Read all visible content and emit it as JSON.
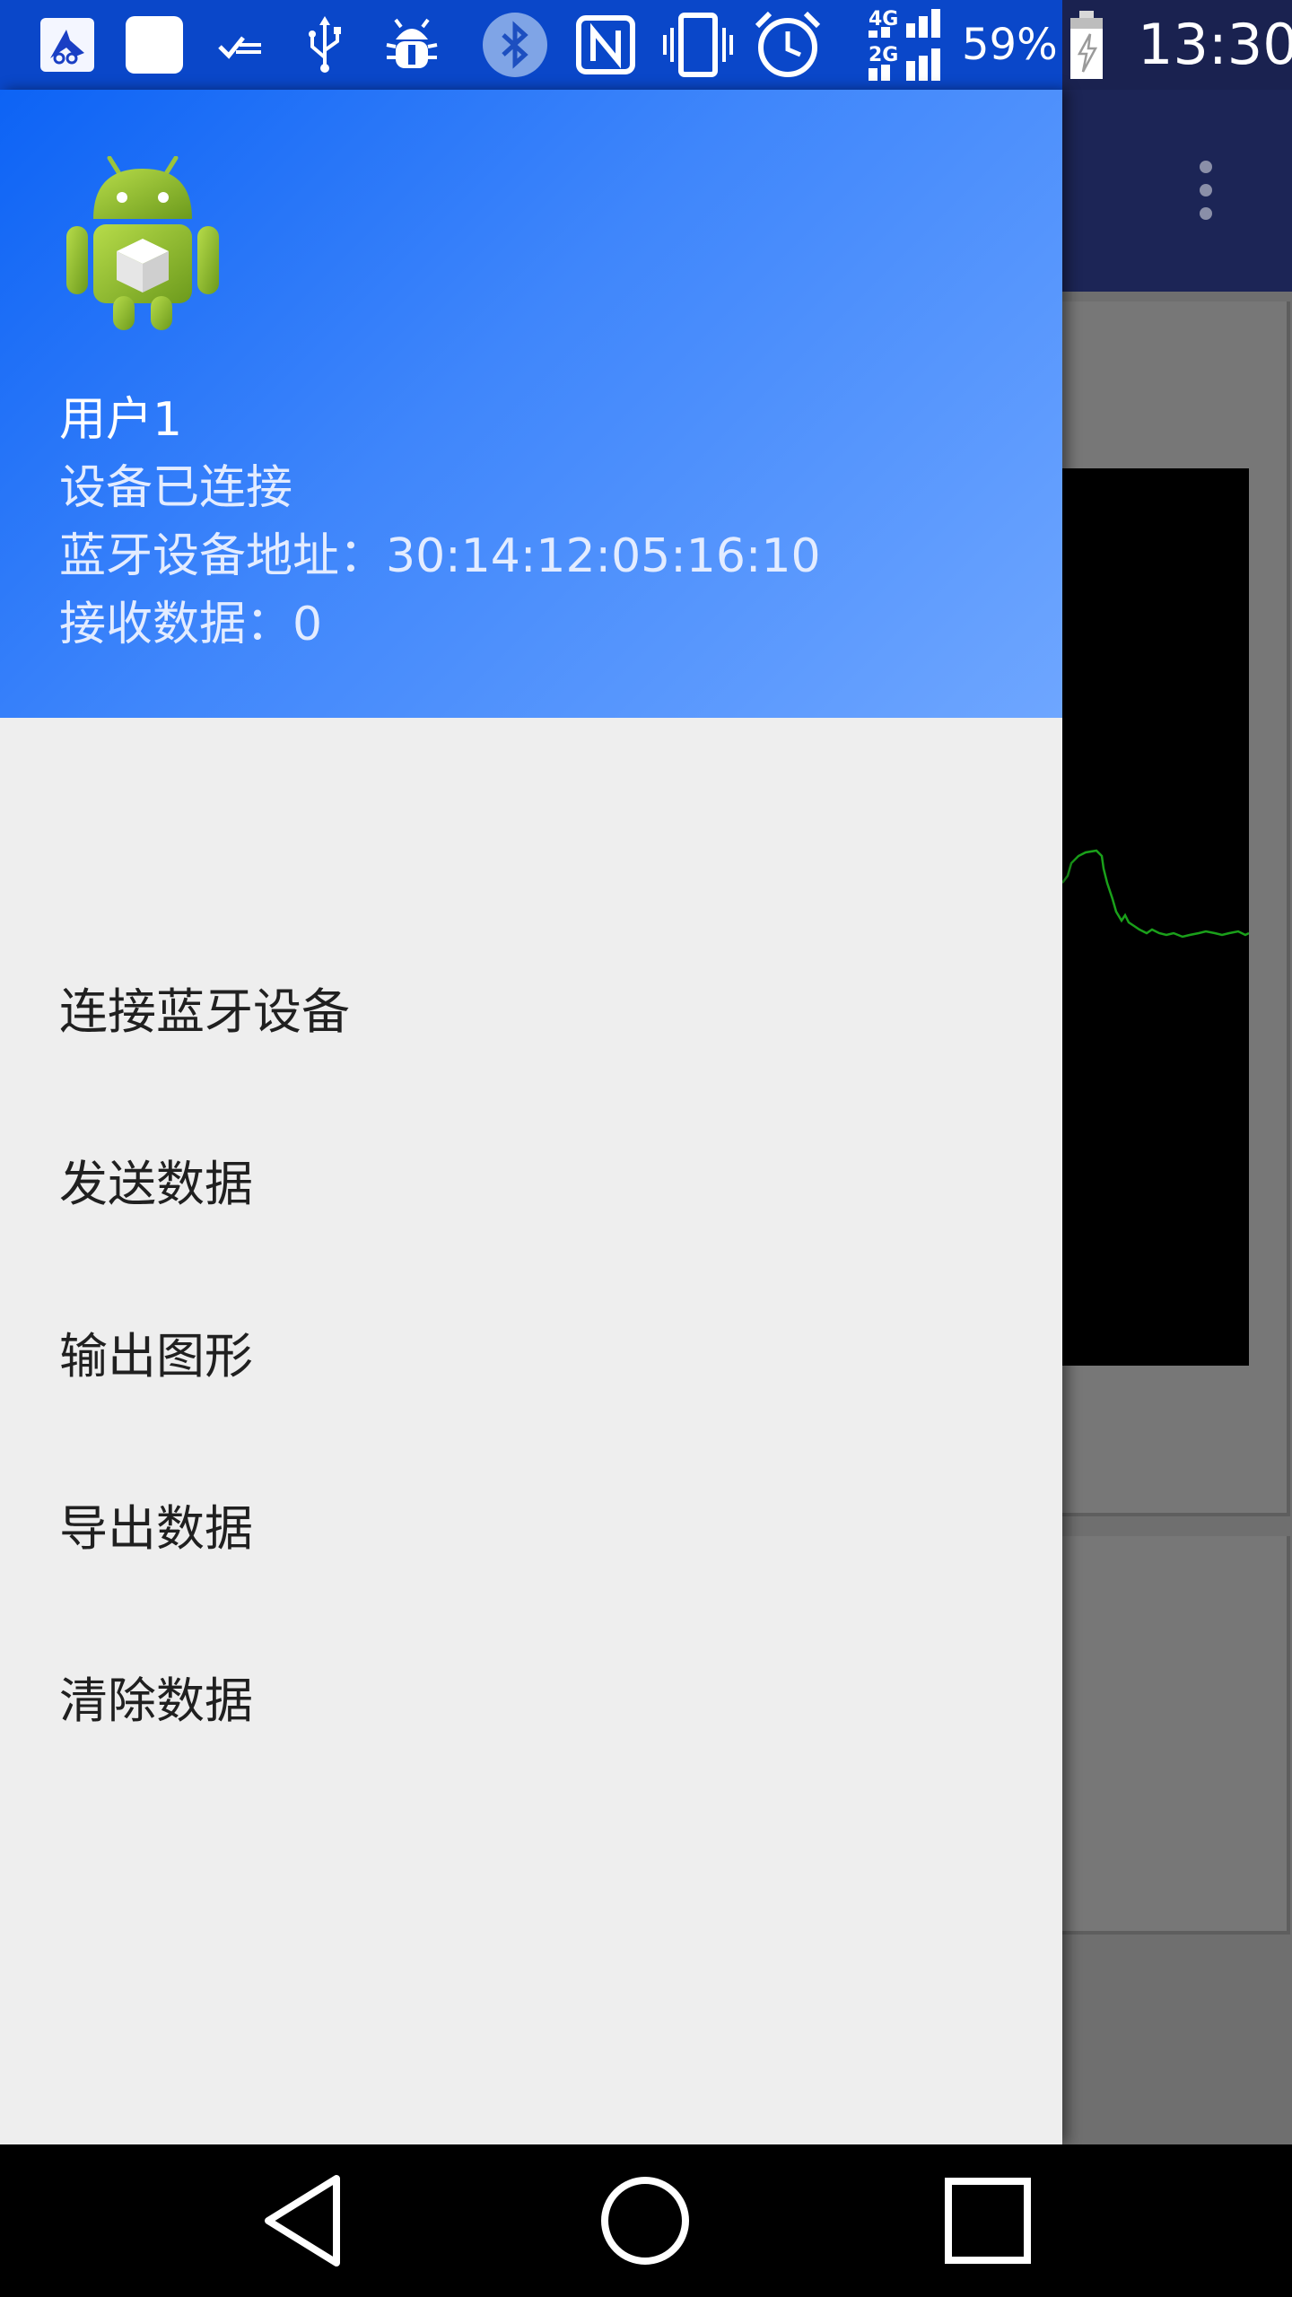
{
  "status_bar": {
    "battery_percent": "59%",
    "time": "13:30",
    "network_labels": [
      "4G",
      "2G"
    ],
    "icons": [
      "app-notification-icon",
      "blank-notification-icon",
      "sync-check-icon",
      "usb-icon",
      "debug-icon",
      "bluetooth-icon",
      "nfc-icon",
      "vibrate-icon",
      "alarm-icon",
      "signal-icon",
      "battery-charging-icon"
    ]
  },
  "drawer": {
    "header": {
      "avatar_icon": "android-box-icon",
      "username": "用户1",
      "status": "设备已连接",
      "address": "蓝牙设备地址：30:14:12:05:16:10",
      "received": "接收数据：0"
    },
    "menu": [
      {
        "label": "连接蓝牙设备"
      },
      {
        "label": "发送数据"
      },
      {
        "label": "输出图形"
      },
      {
        "label": "导出数据"
      },
      {
        "label": "清除数据"
      }
    ]
  },
  "app": {
    "overflow_icon": "more-vert-icon",
    "plot_line_color": "#1aa01a"
  },
  "nav_bar": {
    "back_icon": "back-triangle-icon",
    "home_icon": "home-circle-icon",
    "recents_icon": "recents-square-icon"
  },
  "colors": {
    "header_gradient_start": "#0d63f5",
    "header_gradient_end": "#6ea6ff",
    "drawer_bg": "#eeeeee",
    "toolbar": "#1c2556"
  }
}
